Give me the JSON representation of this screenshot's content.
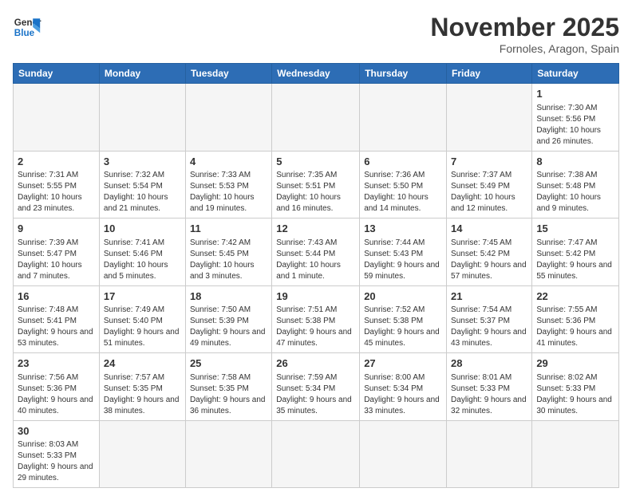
{
  "logo": {
    "line1": "General",
    "line2": "Blue"
  },
  "title": "November 2025",
  "subtitle": "Fornoles, Aragon, Spain",
  "days_header": [
    "Sunday",
    "Monday",
    "Tuesday",
    "Wednesday",
    "Thursday",
    "Friday",
    "Saturday"
  ],
  "weeks": [
    [
      {
        "day": "",
        "info": ""
      },
      {
        "day": "",
        "info": ""
      },
      {
        "day": "",
        "info": ""
      },
      {
        "day": "",
        "info": ""
      },
      {
        "day": "",
        "info": ""
      },
      {
        "day": "",
        "info": ""
      },
      {
        "day": "1",
        "info": "Sunrise: 7:30 AM\nSunset: 5:56 PM\nDaylight: 10 hours and 26 minutes."
      }
    ],
    [
      {
        "day": "2",
        "info": "Sunrise: 7:31 AM\nSunset: 5:55 PM\nDaylight: 10 hours and 23 minutes."
      },
      {
        "day": "3",
        "info": "Sunrise: 7:32 AM\nSunset: 5:54 PM\nDaylight: 10 hours and 21 minutes."
      },
      {
        "day": "4",
        "info": "Sunrise: 7:33 AM\nSunset: 5:53 PM\nDaylight: 10 hours and 19 minutes."
      },
      {
        "day": "5",
        "info": "Sunrise: 7:35 AM\nSunset: 5:51 PM\nDaylight: 10 hours and 16 minutes."
      },
      {
        "day": "6",
        "info": "Sunrise: 7:36 AM\nSunset: 5:50 PM\nDaylight: 10 hours and 14 minutes."
      },
      {
        "day": "7",
        "info": "Sunrise: 7:37 AM\nSunset: 5:49 PM\nDaylight: 10 hours and 12 minutes."
      },
      {
        "day": "8",
        "info": "Sunrise: 7:38 AM\nSunset: 5:48 PM\nDaylight: 10 hours and 9 minutes."
      }
    ],
    [
      {
        "day": "9",
        "info": "Sunrise: 7:39 AM\nSunset: 5:47 PM\nDaylight: 10 hours and 7 minutes."
      },
      {
        "day": "10",
        "info": "Sunrise: 7:41 AM\nSunset: 5:46 PM\nDaylight: 10 hours and 5 minutes."
      },
      {
        "day": "11",
        "info": "Sunrise: 7:42 AM\nSunset: 5:45 PM\nDaylight: 10 hours and 3 minutes."
      },
      {
        "day": "12",
        "info": "Sunrise: 7:43 AM\nSunset: 5:44 PM\nDaylight: 10 hours and 1 minute."
      },
      {
        "day": "13",
        "info": "Sunrise: 7:44 AM\nSunset: 5:43 PM\nDaylight: 9 hours and 59 minutes."
      },
      {
        "day": "14",
        "info": "Sunrise: 7:45 AM\nSunset: 5:42 PM\nDaylight: 9 hours and 57 minutes."
      },
      {
        "day": "15",
        "info": "Sunrise: 7:47 AM\nSunset: 5:42 PM\nDaylight: 9 hours and 55 minutes."
      }
    ],
    [
      {
        "day": "16",
        "info": "Sunrise: 7:48 AM\nSunset: 5:41 PM\nDaylight: 9 hours and 53 minutes."
      },
      {
        "day": "17",
        "info": "Sunrise: 7:49 AM\nSunset: 5:40 PM\nDaylight: 9 hours and 51 minutes."
      },
      {
        "day": "18",
        "info": "Sunrise: 7:50 AM\nSunset: 5:39 PM\nDaylight: 9 hours and 49 minutes."
      },
      {
        "day": "19",
        "info": "Sunrise: 7:51 AM\nSunset: 5:38 PM\nDaylight: 9 hours and 47 minutes."
      },
      {
        "day": "20",
        "info": "Sunrise: 7:52 AM\nSunset: 5:38 PM\nDaylight: 9 hours and 45 minutes."
      },
      {
        "day": "21",
        "info": "Sunrise: 7:54 AM\nSunset: 5:37 PM\nDaylight: 9 hours and 43 minutes."
      },
      {
        "day": "22",
        "info": "Sunrise: 7:55 AM\nSunset: 5:36 PM\nDaylight: 9 hours and 41 minutes."
      }
    ],
    [
      {
        "day": "23",
        "info": "Sunrise: 7:56 AM\nSunset: 5:36 PM\nDaylight: 9 hours and 40 minutes."
      },
      {
        "day": "24",
        "info": "Sunrise: 7:57 AM\nSunset: 5:35 PM\nDaylight: 9 hours and 38 minutes."
      },
      {
        "day": "25",
        "info": "Sunrise: 7:58 AM\nSunset: 5:35 PM\nDaylight: 9 hours and 36 minutes."
      },
      {
        "day": "26",
        "info": "Sunrise: 7:59 AM\nSunset: 5:34 PM\nDaylight: 9 hours and 35 minutes."
      },
      {
        "day": "27",
        "info": "Sunrise: 8:00 AM\nSunset: 5:34 PM\nDaylight: 9 hours and 33 minutes."
      },
      {
        "day": "28",
        "info": "Sunrise: 8:01 AM\nSunset: 5:33 PM\nDaylight: 9 hours and 32 minutes."
      },
      {
        "day": "29",
        "info": "Sunrise: 8:02 AM\nSunset: 5:33 PM\nDaylight: 9 hours and 30 minutes."
      }
    ],
    [
      {
        "day": "30",
        "info": "Sunrise: 8:03 AM\nSunset: 5:33 PM\nDaylight: 9 hours and 29 minutes."
      },
      {
        "day": "",
        "info": ""
      },
      {
        "day": "",
        "info": ""
      },
      {
        "day": "",
        "info": ""
      },
      {
        "day": "",
        "info": ""
      },
      {
        "day": "",
        "info": ""
      },
      {
        "day": "",
        "info": ""
      }
    ]
  ]
}
